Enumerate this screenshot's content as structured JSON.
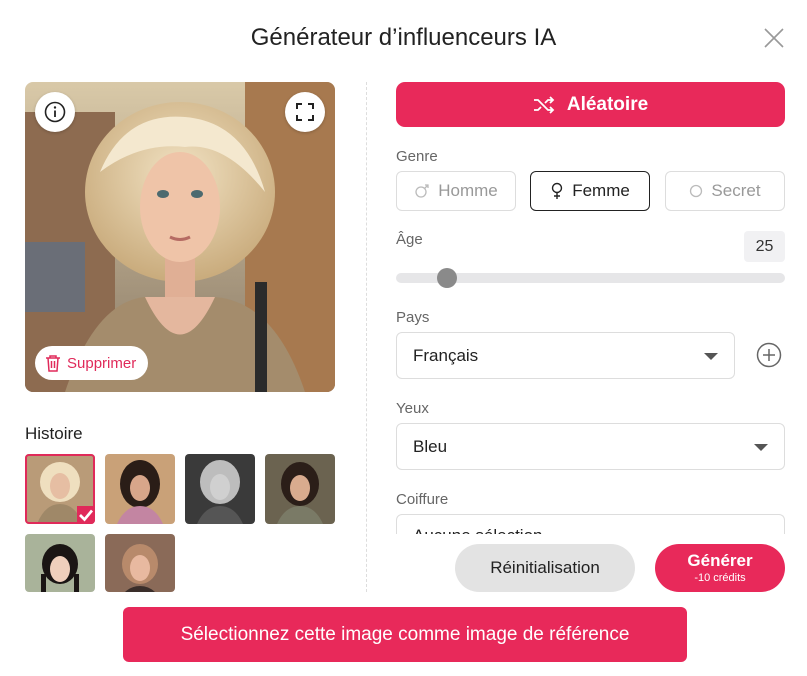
{
  "dialog": {
    "title": "Générateur d’influenceurs IA"
  },
  "preview": {
    "delete_label": "Supprimer"
  },
  "history": {
    "label": "Histoire"
  },
  "form": {
    "random_label": "Aléatoire",
    "gender": {
      "label": "Genre",
      "options": [
        "Homme",
        "Femme",
        "Secret"
      ],
      "selected": "Femme"
    },
    "age": {
      "label": "Âge",
      "value": "25",
      "fraction": 0.11
    },
    "country": {
      "label": "Pays",
      "value": "Français"
    },
    "eyes": {
      "label": "Yeux",
      "value": "Bleu"
    },
    "hair": {
      "label": "Coiffure",
      "value": "Aucune sélection"
    }
  },
  "actions": {
    "reset_label": "Réinitialisation",
    "generate_label": "Générer",
    "generate_cost": "-10 crédits",
    "reference_label": "Sélectionnez cette image comme image de référence"
  },
  "colors": {
    "accent": "#e8295a",
    "accent_text": "#e02a5a"
  }
}
